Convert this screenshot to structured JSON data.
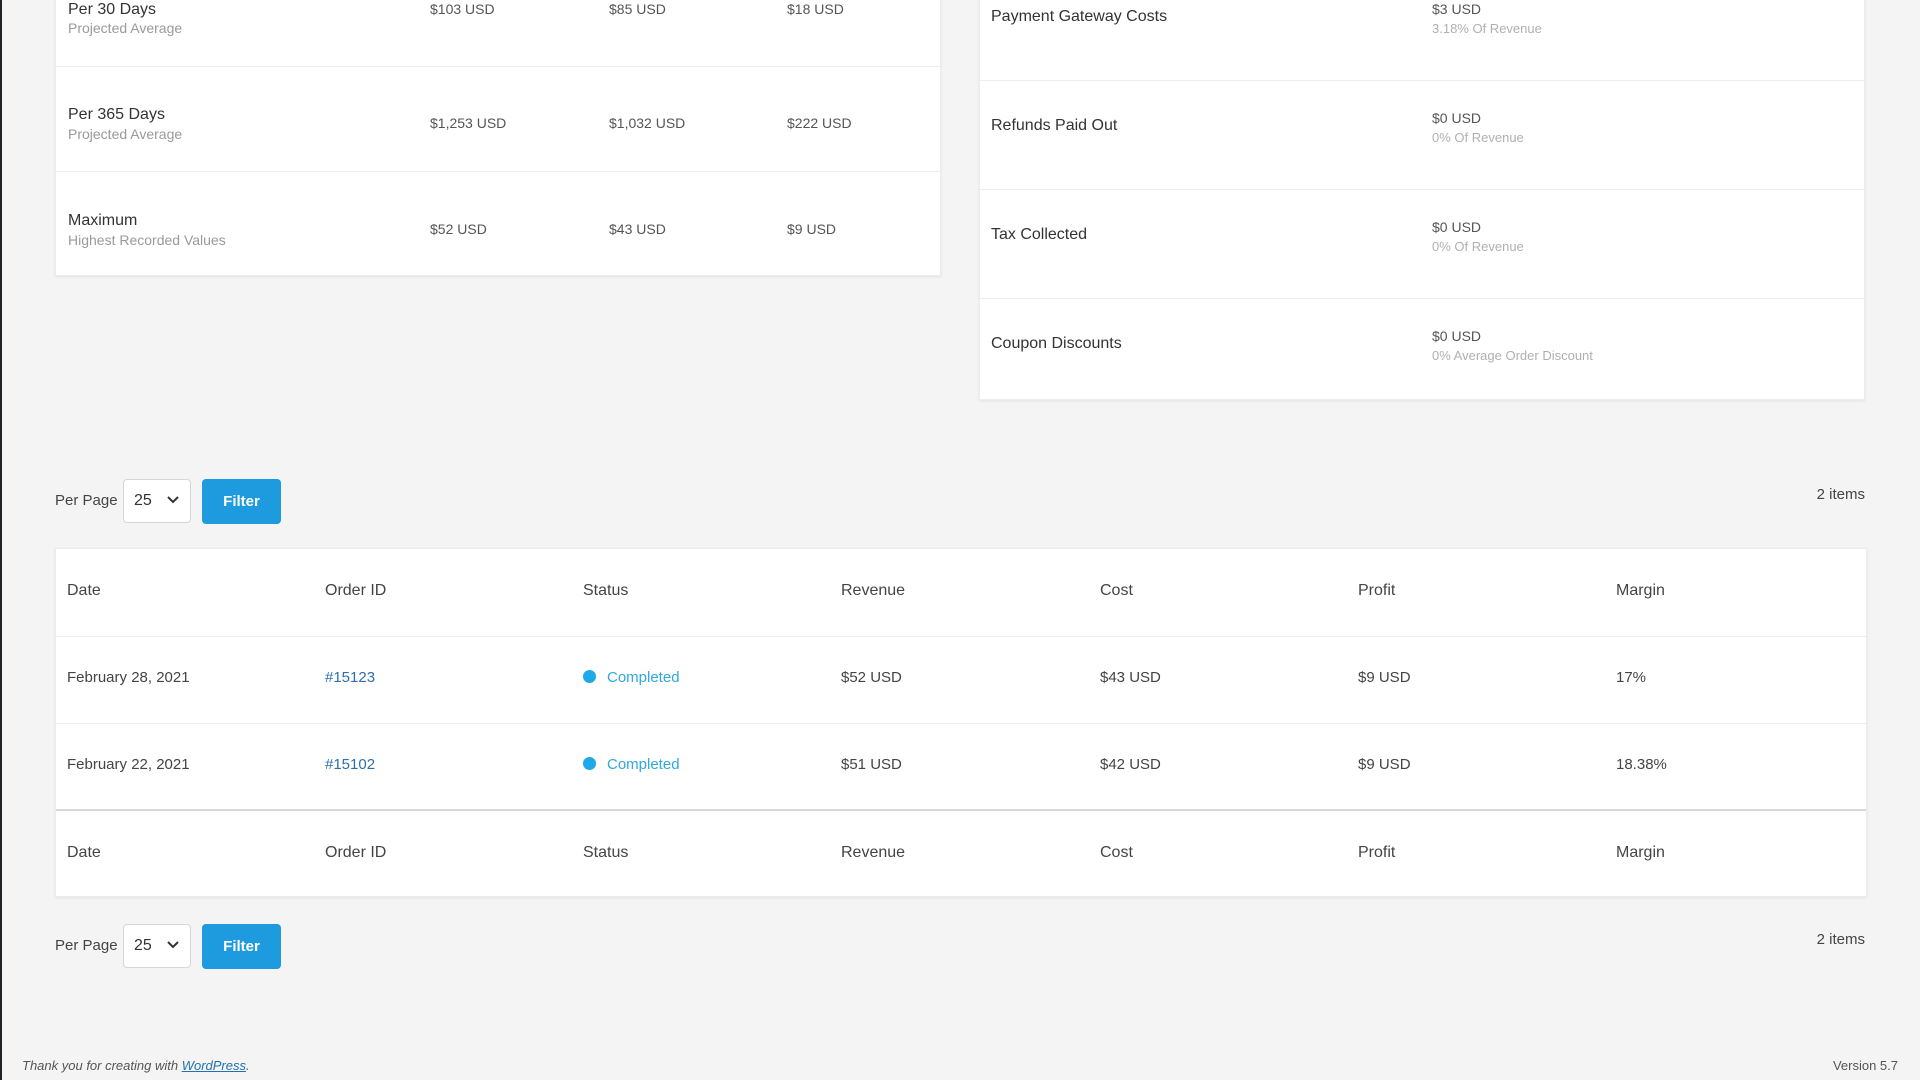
{
  "stats": {
    "rows": [
      {
        "title": "Per 30 Days",
        "subtitle": "Projected Average",
        "values": [
          "$103 USD",
          "$85 USD",
          "$18 USD"
        ]
      },
      {
        "title": "Per 365 Days",
        "subtitle": "Projected Average",
        "values": [
          "$1,253 USD",
          "$1,032 USD",
          "$222 USD"
        ]
      },
      {
        "title": "Maximum",
        "subtitle": "Highest Recorded Values",
        "values": [
          "$52 USD",
          "$43 USD",
          "$9 USD"
        ]
      }
    ]
  },
  "costs": {
    "rows": [
      {
        "label": "Payment Gateway Costs",
        "value": "$3 USD",
        "sub": "3.18% Of Revenue"
      },
      {
        "label": "Refunds Paid Out",
        "value": "$0 USD",
        "sub": "0% Of Revenue"
      },
      {
        "label": "Tax Collected",
        "value": "$0 USD",
        "sub": "0% Of Revenue"
      },
      {
        "label": "Coupon Discounts",
        "value": "$0 USD",
        "sub": "0% Average Order Discount"
      }
    ]
  },
  "pager": {
    "per_page_label": "Per Page",
    "per_page_value": "25",
    "filter_label": "Filter",
    "items_count": "2 items"
  },
  "orders": {
    "columns": [
      "Date",
      "Order ID",
      "Status",
      "Revenue",
      "Cost",
      "Profit",
      "Margin"
    ],
    "rows": [
      {
        "date": "February 28, 2021",
        "order_id": "#15123",
        "status": "Completed",
        "revenue": "$52 USD",
        "cost": "$43 USD",
        "profit": "$9 USD",
        "margin": "17%"
      },
      {
        "date": "February 22, 2021",
        "order_id": "#15102",
        "status": "Completed",
        "revenue": "$51 USD",
        "cost": "$42 USD",
        "profit": "$9 USD",
        "margin": "18.38%"
      }
    ]
  },
  "footer": {
    "thanks_prefix": "Thank you for creating with ",
    "wp_link": "WordPress",
    "thanks_suffix": ".",
    "version": "Version 5.7"
  },
  "colors": {
    "accent": "#1e9bdf",
    "status_dot": "#1ea9e8",
    "link": "#2f6fa8"
  }
}
